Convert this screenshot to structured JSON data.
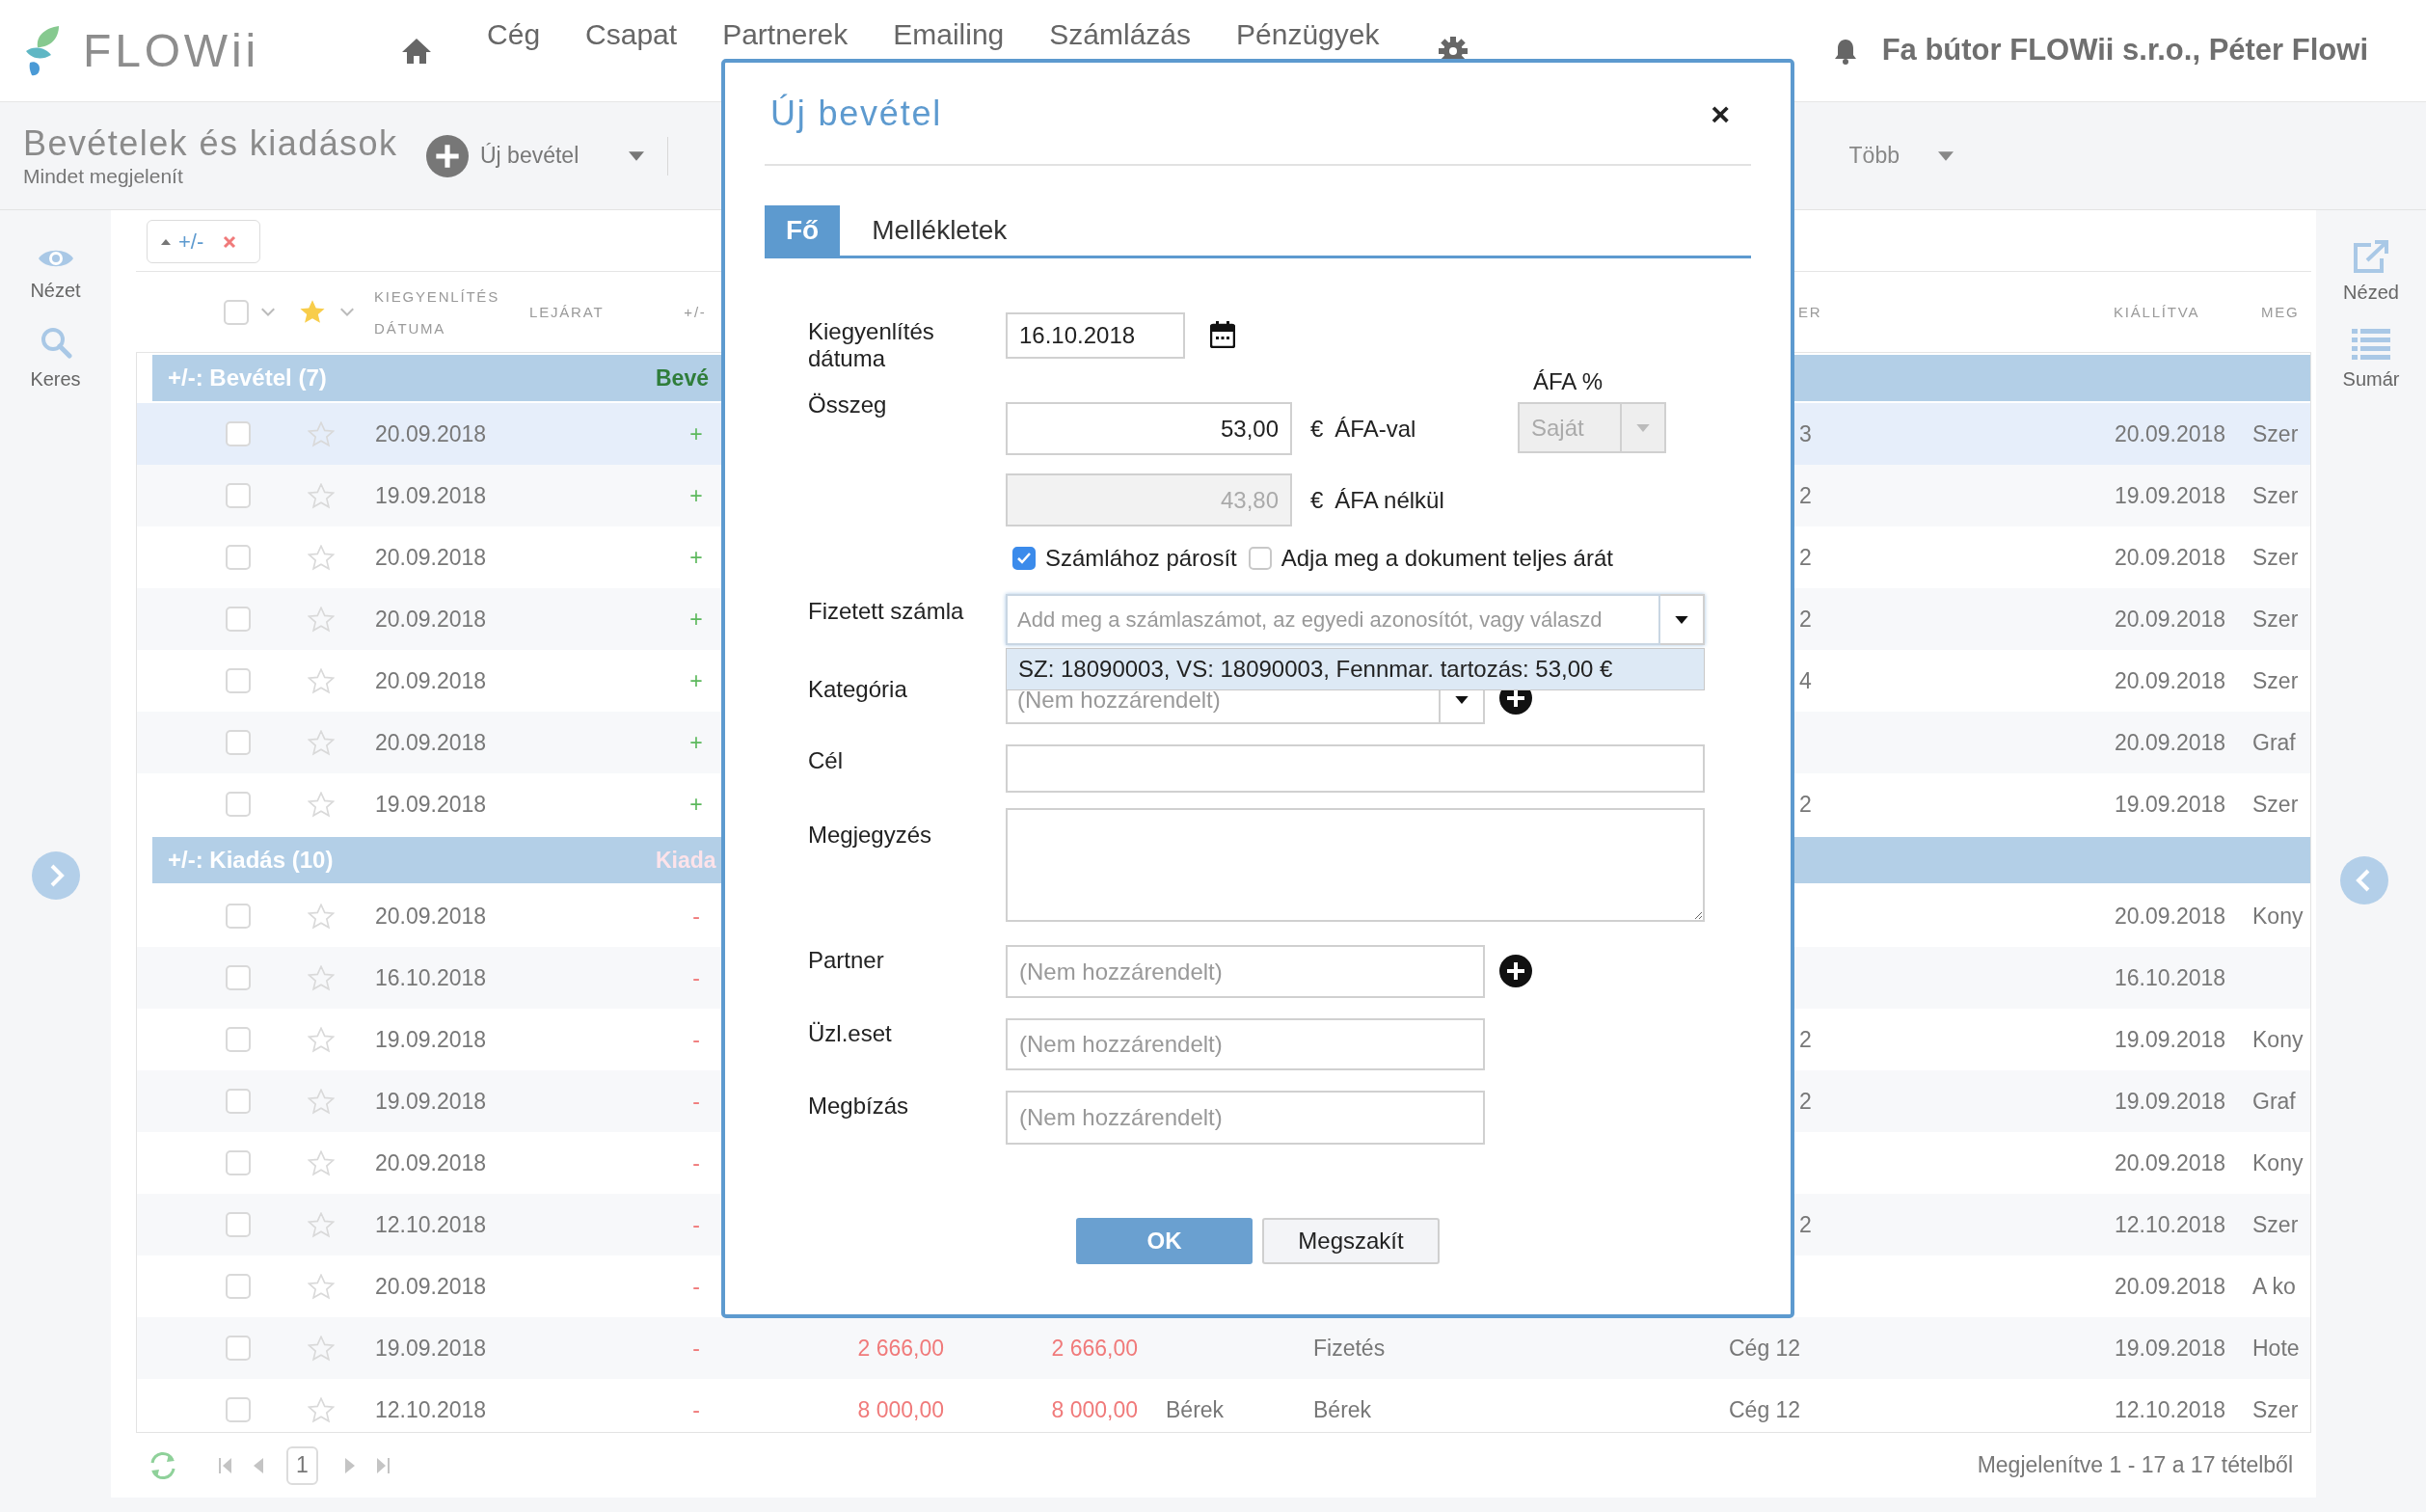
{
  "top_bar": {
    "logo_text": "FLOWii",
    "nav": [
      "Cég",
      "Csapat",
      "Partnerek",
      "Emailing",
      "Számlázás",
      "Pénzügyek"
    ],
    "account": "Fa bútor FLOWii s.r.o., Péter Flowi"
  },
  "page_header": {
    "title": "Bevételek és kiadások",
    "subtitle": "Mindet megjelenít",
    "new_button": "Új bevétel",
    "more": "Több"
  },
  "left_sidebar": [
    {
      "kind": "eye",
      "label": "Nézet"
    },
    {
      "kind": "search",
      "label": "Keres"
    }
  ],
  "right_sidebar": [
    {
      "kind": "export",
      "label": "Nézed"
    },
    {
      "kind": "list",
      "label": "Sumár"
    }
  ],
  "filter_chip": {
    "label": "+/-"
  },
  "table": {
    "select_all": {
      "checked": false
    },
    "columns": [
      "KIEGYENLÍTÉS DÁTUMA",
      "LEJÁRAT",
      "+/-",
      "ER",
      "KIÁLLÍTVA",
      "MEG"
    ],
    "groups": [
      {
        "kind": "income",
        "label": "+/-: Bevétel (7)",
        "summary": "Bevé",
        "rows": [
          {
            "settled": "20.09.2018",
            "sign": "+",
            "partner_tail": "3",
            "issued": "20.09.2018",
            "note": "Szer",
            "highlighted": true
          },
          {
            "settled": "19.09.2018",
            "sign": "+",
            "partner_tail": "2",
            "issued": "19.09.2018",
            "note": "Szer",
            "highlighted": false
          },
          {
            "settled": "20.09.2018",
            "sign": "+",
            "partner_tail": "2",
            "issued": "20.09.2018",
            "note": "Szer",
            "highlighted": false
          },
          {
            "settled": "20.09.2018",
            "sign": "+",
            "partner_tail": "2",
            "issued": "20.09.2018",
            "note": "Szer",
            "highlighted": false
          },
          {
            "settled": "20.09.2018",
            "sign": "+",
            "partner_tail": "4",
            "issued": "20.09.2018",
            "note": "Szer",
            "highlighted": false
          },
          {
            "settled": "20.09.2018",
            "sign": "+",
            "issued": "20.09.2018",
            "note": "Graf",
            "highlighted": false
          },
          {
            "settled": "19.09.2018",
            "sign": "+",
            "partner_tail": "2",
            "issued": "19.09.2018",
            "note": "Szer",
            "highlighted": false
          }
        ]
      },
      {
        "kind": "expense",
        "label": "+/-: Kiadás (10)",
        "summary": "Kiada",
        "rows": [
          {
            "settled": "20.09.2018",
            "sign": "-",
            "issued": "20.09.2018",
            "note": "Kony",
            "highlighted": false
          },
          {
            "settled": "16.10.2018",
            "sign": "-",
            "issued": "16.10.2018",
            "highlighted": false
          },
          {
            "settled": "19.09.2018",
            "sign": "-",
            "partner_tail": "2",
            "issued": "19.09.2018",
            "note": "Kony",
            "highlighted": false
          },
          {
            "settled": "19.09.2018",
            "sign": "-",
            "partner_tail": "2",
            "issued": "19.09.2018",
            "note": "Graf",
            "highlighted": false
          },
          {
            "settled": "20.09.2018",
            "sign": "-",
            "issued": "20.09.2018",
            "note": "Kony",
            "highlighted": false
          },
          {
            "settled": "12.10.2018",
            "sign": "-",
            "partner_tail": "2",
            "issued": "12.10.2018",
            "note": "Szer",
            "highlighted": false
          },
          {
            "settled": "20.09.2018",
            "sign": "-",
            "issued": "20.09.2018",
            "note": "A ko",
            "highlighted": false
          },
          {
            "settled": "19.09.2018",
            "sign": "-",
            "amount_a": "2 666,00",
            "amount_b": "2 666,00",
            "column_b": "Fizetés",
            "partner": "Cég 12",
            "issued": "19.09.2018",
            "note": "Hote",
            "highlighted": false
          },
          {
            "settled": "12.10.2018",
            "sign": "-",
            "amount_a": "8 000,00",
            "amount_b": "8 000,00",
            "column_a": "Bérek",
            "column_b": "Bérek",
            "partner": "Cég 12",
            "issued": "12.10.2018",
            "note": "Szer",
            "highlighted": false
          }
        ]
      }
    ]
  },
  "footer": {
    "page": "1",
    "summary": "Megjelenítve 1 - 17 a 17 tételből"
  },
  "dialog": {
    "title": "Új bevétel",
    "close": "×",
    "tabs": [
      {
        "label": "Fő",
        "selected": true
      },
      {
        "label": "Mellékletek",
        "selected": false
      }
    ],
    "settle_date": {
      "label": "Kiegyenlítés dátuma",
      "value": "16.10.2018"
    },
    "amount": {
      "label": "Összeg",
      "gross": "53,00",
      "gross_unit": "€",
      "gross_label": "ÁFA-val",
      "net": "43,80",
      "net_unit": "€",
      "net_label": "ÁFA nélkül",
      "vat_label": "ÁFA %",
      "vat_value": "Saját"
    },
    "checks": [
      {
        "label": "Számlához párosít",
        "checked": true
      },
      {
        "label": "Adja meg a dokument teljes árát",
        "checked": false
      }
    ],
    "paid_invoice": {
      "label": "Fizetett számla",
      "placeholder": "Add meg a számlaszámot, az egyedi azonosítót, vagy válaszd",
      "options": [
        "SZ: 18090003, VS: 18090003, Fennmar. tartozás: 53,00 €"
      ]
    },
    "category": {
      "label": "Kategória",
      "placeholder": "(Nem hozzárendelt)"
    },
    "goal": {
      "label": "Cél"
    },
    "note": {
      "label": "Megjegyzés"
    },
    "partner": {
      "label": "Partner",
      "placeholder": "(Nem hozzárendelt)"
    },
    "business_case": {
      "label": "Üzl.eset",
      "placeholder": "(Nem hozzárendelt)"
    },
    "order": {
      "label": "Megbízás",
      "placeholder": "(Nem hozzárendelt)"
    },
    "buttons": [
      {
        "kind": "primary",
        "label": "OK"
      },
      {
        "kind": "secondary",
        "label": "Megszakít"
      }
    ]
  }
}
